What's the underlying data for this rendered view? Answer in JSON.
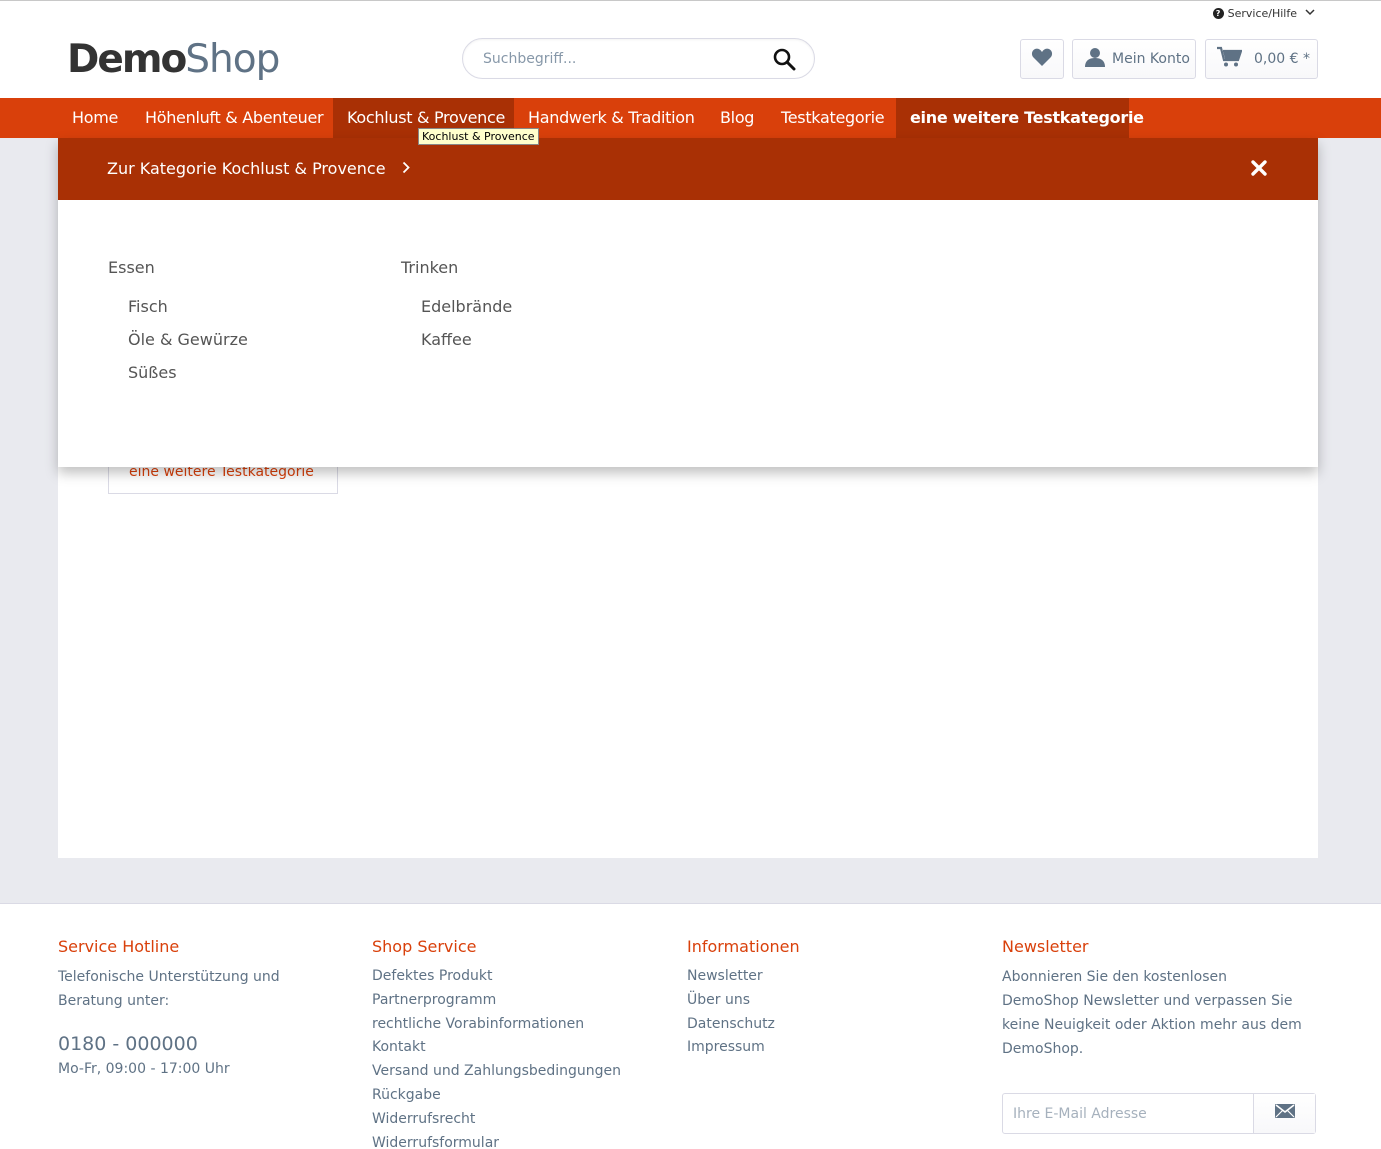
{
  "header": {
    "service_label": "Service/Hilfe",
    "logo_bold": "Demo",
    "logo_light": "Shop",
    "search_placeholder": "Suchbegriff...",
    "account_label": "Mein Konto",
    "cart_total": "0,00 € *"
  },
  "nav": {
    "items": [
      "Home",
      "Höhenluft & Abenteuer",
      "Kochlust & Provence",
      "Handwerk & Tradition",
      "Blog",
      "Testkategorie",
      "eine weitere Testkategorie"
    ],
    "active": "Kochlust & Provence",
    "tooltip": "Kochlust & Provence"
  },
  "dropdown": {
    "title": "Zur Kategorie Kochlust & Provence",
    "columns": [
      {
        "label": "Essen",
        "children": [
          "Fisch",
          "Öle & Gewürze",
          "Süßes"
        ]
      },
      {
        "label": "Trinken",
        "children": [
          "Edelbrände",
          "Kaffee"
        ]
      }
    ]
  },
  "sidebar": {
    "visible_item": "eine weitere Testkategorie"
  },
  "footer": {
    "hotline": {
      "title": "Service Hotline",
      "text": "Telefonische Unterstützung und Beratung unter:",
      "phone": "0180 - 000000",
      "hours": "Mo-Fr, 09:00 - 17:00 Uhr"
    },
    "shop_service": {
      "title": "Shop Service",
      "links": [
        "Defektes Produkt",
        "Partnerprogramm",
        "rechtliche Vorabinformationen",
        "Kontakt",
        "Versand und Zahlungsbedingungen",
        "Rückgabe",
        "Widerrufsrecht",
        "Widerrufsformular"
      ]
    },
    "information": {
      "title": "Informationen",
      "links": [
        "Newsletter",
        "Über uns",
        "Datenschutz",
        "Impressum"
      ]
    },
    "newsletter": {
      "title": "Newsletter",
      "text": "Abonnieren Sie den kostenlosen DemoShop Newsletter und verpassen Sie keine Neuigkeit oder Aktion mehr aus dem DemoShop.",
      "placeholder": "Ihre E-Mail Adresse"
    }
  },
  "colors": {
    "brand": "#d9400b",
    "brand_dark": "#a93005",
    "text": "#5f7285"
  }
}
